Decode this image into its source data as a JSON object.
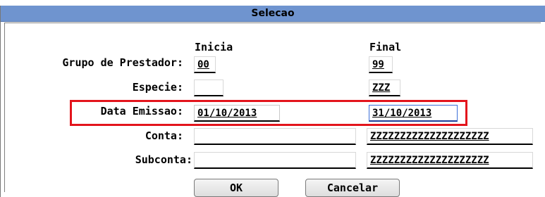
{
  "window": {
    "title": "Selecao"
  },
  "columns": {
    "initial": "Inicia",
    "final": "Final"
  },
  "rows": [
    {
      "label": "Grupo de Prestador:",
      "initial": "00",
      "final": "99"
    },
    {
      "label": "Especie:",
      "initial": "",
      "final": "ZZZ"
    },
    {
      "label": "Data Emissao:",
      "initial": "01/10/2013",
      "final": "31/10/2013"
    },
    {
      "label": "Conta:",
      "initial": "",
      "final": "ZZZZZZZZZZZZZZZZZZZZ"
    },
    {
      "label": "Subconta:",
      "initial": "",
      "final": "ZZZZZZZZZZZZZZZZZZZZ"
    }
  ],
  "buttons": {
    "ok": "OK",
    "cancel": "Cancelar"
  },
  "annotation": {
    "color": "#e3141c"
  }
}
